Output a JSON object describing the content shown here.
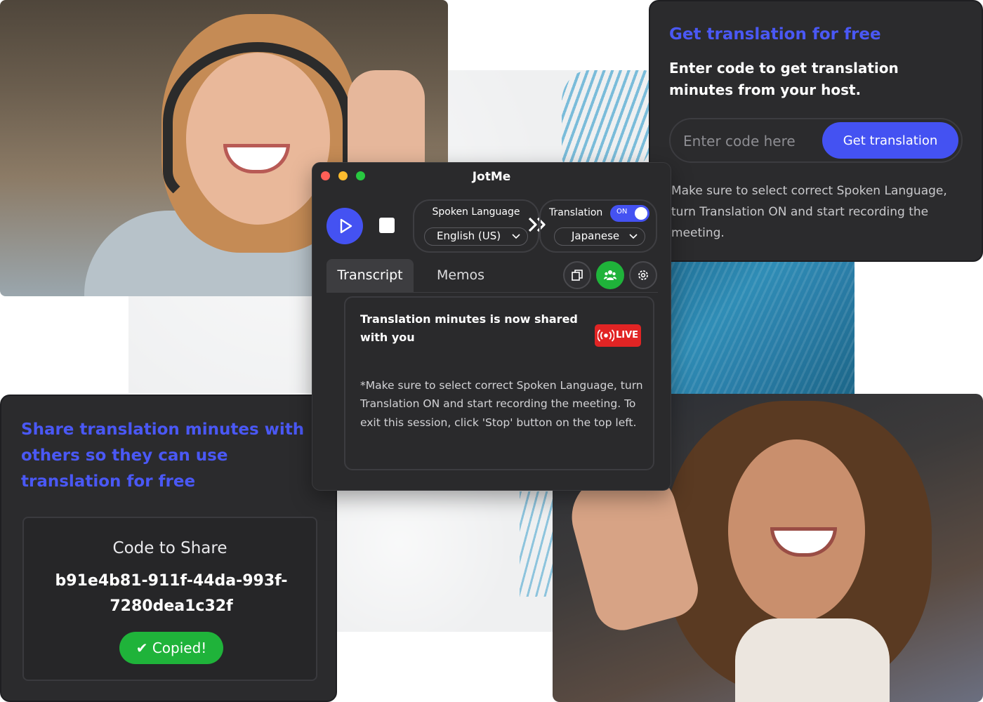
{
  "get_card": {
    "title": "Get translation for free",
    "subtitle": "Enter code to get translation minutes from your host.",
    "code_placeholder": "Enter code here",
    "button_label": "Get translation",
    "note": "Make sure to select correct Spoken Language, turn Translation ON and start recording the meeting."
  },
  "share_card": {
    "title": "Share translation minutes with others so they can use translation for free",
    "code_label": "Code to Share",
    "code_value": "b91e4b81-911f-44da-993f-7280dea1c32f",
    "copied_label": "✔ Copied!"
  },
  "app": {
    "window_title": "JotMe",
    "spoken_language_label": "Spoken Language",
    "spoken_language_value": "English (US)",
    "translation_label": "Translation",
    "toggle_state": "ON",
    "translation_language_value": "Japanese",
    "tabs": [
      {
        "label": "Transcript",
        "active": true
      },
      {
        "label": "Memos",
        "active": false
      }
    ],
    "notice": {
      "title": "Translation minutes is now shared with you",
      "badge": "LIVE",
      "body": "*Make sure to select correct Spoken Language, turn Translation ON and start recording the meeting. To exit this session, click 'Stop' button on the top left."
    }
  },
  "icons": {
    "play": "play-icon",
    "stop": "stop-icon",
    "chevron": "chevron-down-icon",
    "arrows": "double-chevron-right-icon",
    "copy": "copy-window-icon",
    "share": "group-users-icon",
    "settings": "gear-icon",
    "live": "broadcast-icon"
  },
  "colors": {
    "accent": "#4452f2",
    "title_blue": "#4a58f5",
    "success": "#1fb33a",
    "live_red": "#e12424",
    "card_bg": "#2b2b2d"
  }
}
